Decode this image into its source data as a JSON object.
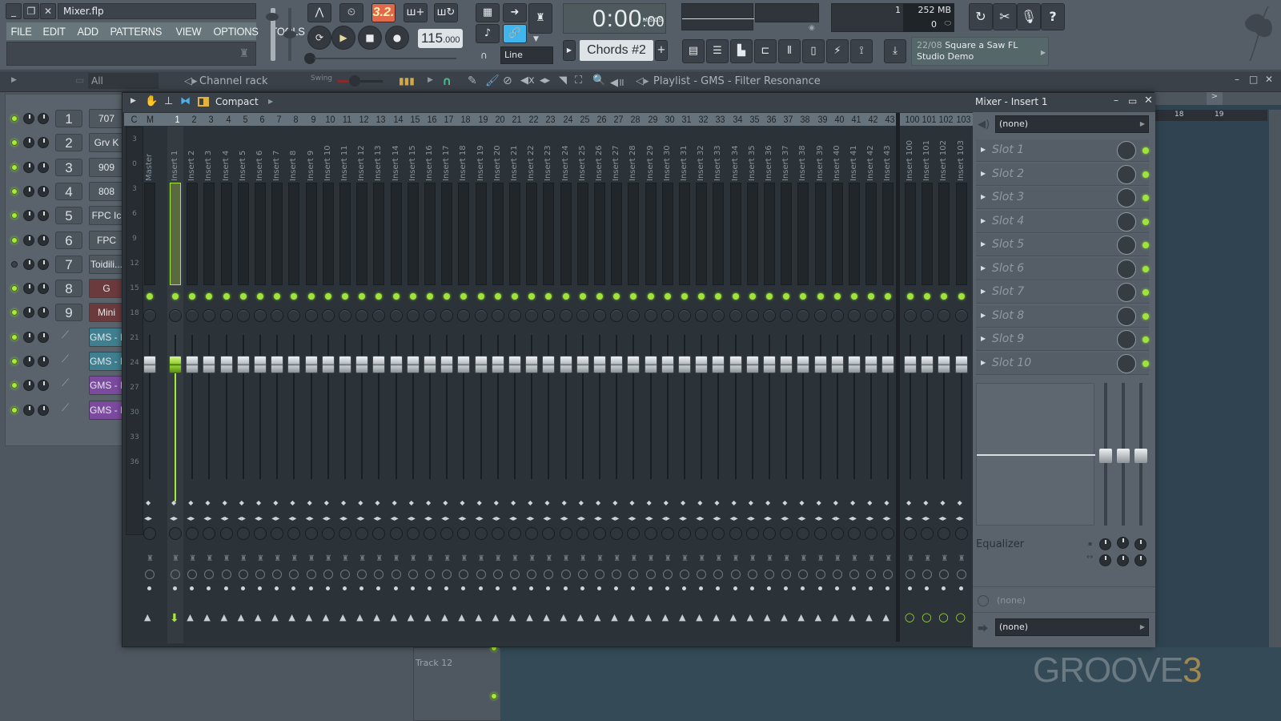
{
  "window": {
    "title": "Mixer.flp",
    "controls": [
      "minimize",
      "restore",
      "close"
    ]
  },
  "menu": [
    "FILE",
    "EDIT",
    "ADD",
    "PATTERNS",
    "VIEW",
    "OPTIONS",
    "TOOLS",
    "?"
  ],
  "transport": {
    "pattern_song_mode": "3.2.",
    "tempo_int": "115",
    "tempo_frac": ".000",
    "time_main": "0:00",
    "time_small": ":00",
    "time_label": "M:S:CS",
    "snap": "Line",
    "pattern_name": "Chords #2",
    "pattern_add": "+"
  },
  "monitor": {
    "cpu_polyphony": "1",
    "memory": "252 MB",
    "voices": "0"
  },
  "hint": {
    "date": "22/08",
    "line1": "Square a Saw FL",
    "line2": "Studio Demo"
  },
  "toolbar2": {
    "filter": "All",
    "channel_rack_title": "Channel rack",
    "swing_label": "Swing",
    "playlist_title": "Playlist - GMS - Filter Resonance"
  },
  "channel_rack": {
    "rows": [
      {
        "num": "1",
        "name": "707",
        "color": "grey",
        "led": true
      },
      {
        "num": "2",
        "name": "Grv K",
        "color": "grey",
        "led": true
      },
      {
        "num": "3",
        "name": "909",
        "color": "grey",
        "led": true
      },
      {
        "num": "4",
        "name": "808",
        "color": "grey",
        "led": true
      },
      {
        "num": "5",
        "name": "FPC Ic",
        "color": "grey",
        "led": true
      },
      {
        "num": "6",
        "name": "FPC",
        "color": "grey",
        "led": true
      },
      {
        "num": "7",
        "name": "Toidili...",
        "color": "grey",
        "led": false
      },
      {
        "num": "8",
        "name": "G",
        "color": "red",
        "led": true
      },
      {
        "num": "9",
        "name": "Mini",
        "color": "red",
        "led": true
      },
      {
        "num": "",
        "name": "GMS - F",
        "color": "teal",
        "led": true
      },
      {
        "num": "",
        "name": "GMS - F",
        "color": "teal",
        "led": true
      },
      {
        "num": "",
        "name": "GMS - F",
        "color": "purple",
        "led": true
      },
      {
        "num": "",
        "name": "GMS - F",
        "color": "purple",
        "led": true
      }
    ]
  },
  "mixer": {
    "view_mode": "Compact",
    "title": "Mixer - Insert 1",
    "header_cols": [
      "C",
      "M"
    ],
    "master_label": "Master",
    "selected_insert": "1",
    "scale_ticks": [
      "3",
      "0",
      "3",
      "6",
      "9",
      "12",
      "15",
      "18",
      "21",
      "24",
      "27",
      "30",
      "33",
      "36"
    ],
    "inserts": [
      "1",
      "2",
      "3",
      "4",
      "5",
      "6",
      "7",
      "8",
      "9",
      "10",
      "11",
      "12",
      "13",
      "14",
      "15",
      "16",
      "17",
      "18",
      "19",
      "20",
      "21",
      "22",
      "23",
      "24",
      "25",
      "26",
      "27",
      "28",
      "29",
      "30",
      "31",
      "32",
      "33",
      "34",
      "35",
      "36",
      "37",
      "38",
      "39",
      "40",
      "41",
      "42",
      "43"
    ],
    "extra_inserts": [
      "100",
      "101",
      "102",
      "103"
    ],
    "insert_prefix": "Insert ",
    "insert_panel": {
      "input": "(none)",
      "slots": [
        "Slot 1",
        "Slot 2",
        "Slot 3",
        "Slot 4",
        "Slot 5",
        "Slot 6",
        "Slot 7",
        "Slot 8",
        "Slot 9",
        "Slot 10"
      ],
      "eq_label": "Equalizer",
      "latency": "(none)",
      "output": "(none)"
    }
  },
  "playlist": {
    "ruler": [
      "18",
      "19"
    ],
    "track_label": "Track 12"
  },
  "watermark": {
    "text": "GROOVE",
    "number": "3"
  },
  "colors": {
    "accent_green": "#a6ea3a",
    "tempo_mode_orange": "#e0684c",
    "link_blue": "#3fb6ee",
    "teal_channel": "#3f7f8f",
    "purple_channel": "#7c4ba0",
    "red_channel": "#6b3a3d"
  }
}
